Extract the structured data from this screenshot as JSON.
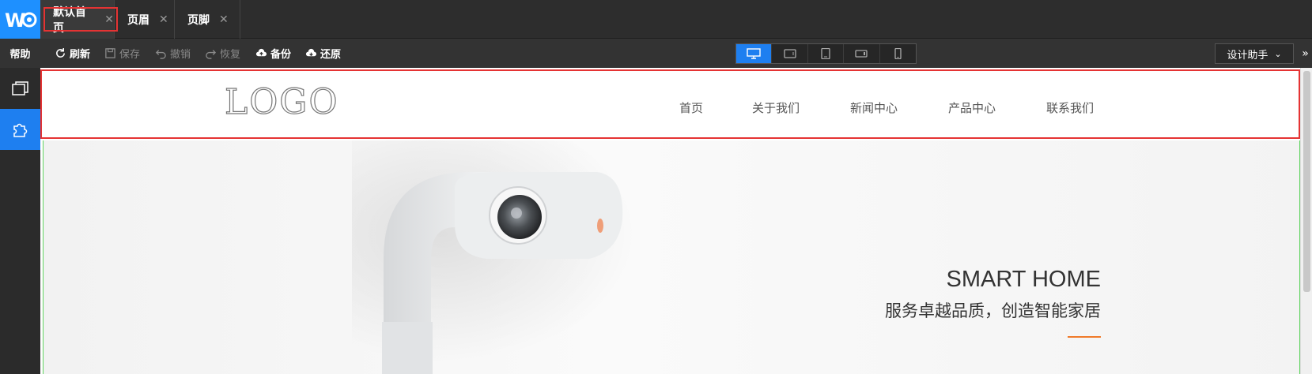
{
  "tabs": [
    {
      "label": "默认首页",
      "active": true
    },
    {
      "label": "页眉",
      "active": false
    },
    {
      "label": "页脚",
      "active": false
    }
  ],
  "toolbar": {
    "help": "帮助",
    "refresh": "刷新",
    "save": "保存",
    "undo": "撤销",
    "redo": "恢复",
    "backup": "备份",
    "restore": "还原",
    "assistant": "设计助手",
    "devices": [
      "desktop-icon",
      "tablet-landscape-icon",
      "tablet-icon",
      "phone-landscape-icon",
      "phone-icon"
    ],
    "active_device": "desktop-icon"
  },
  "sidebar": {
    "items": [
      {
        "icon": "layers-icon",
        "active": false
      },
      {
        "icon": "plugin-icon",
        "active": true
      }
    ]
  },
  "site": {
    "logo": "LOGO",
    "nav": [
      "首页",
      "关于我们",
      "新闻中心",
      "产品中心",
      "联系我们"
    ],
    "hero": {
      "title": "SMART HOME",
      "subtitle": "服务卓越品质，创造智能家居",
      "accent": "#f07a2a"
    }
  },
  "colors": {
    "brand": "#1e90ff",
    "active_blue": "#1e7ff0",
    "selection_red": "#e53333",
    "guide_green": "#5fd35f"
  }
}
